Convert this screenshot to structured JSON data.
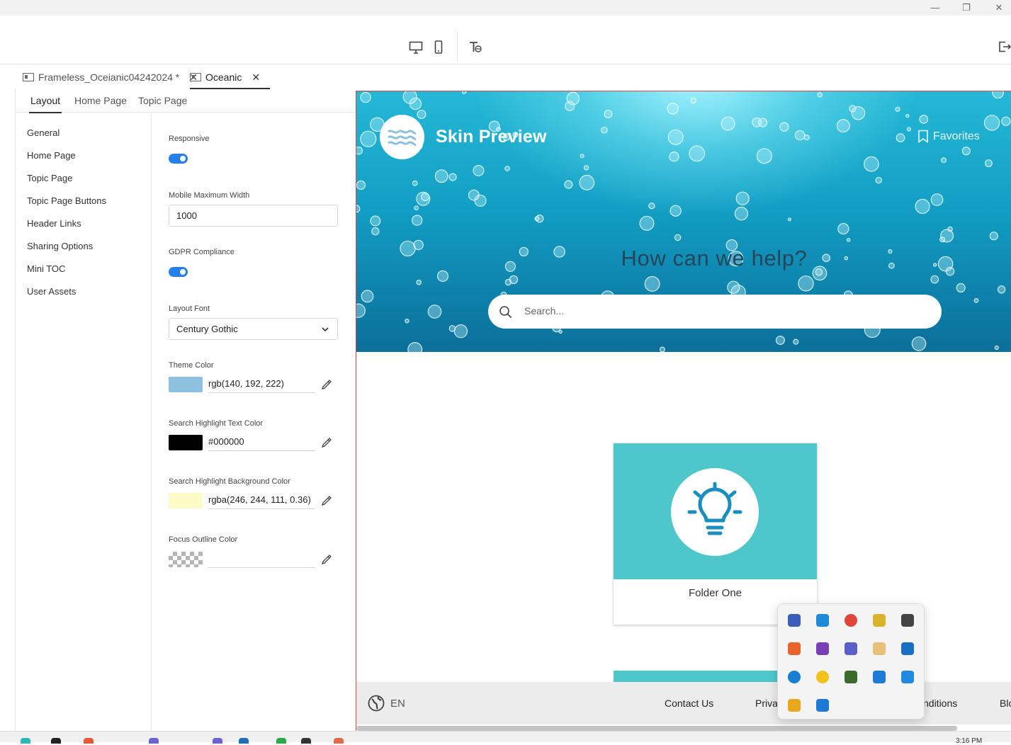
{
  "window": {
    "minimize": "—",
    "restore": "❐",
    "close": "✕"
  },
  "doc_tabs": [
    {
      "label": "Frameless_Oceianic04242024 *",
      "close": "✕"
    },
    {
      "label": "Oceanic",
      "close": "✕"
    }
  ],
  "settings_tabs": [
    "Layout",
    "Home Page",
    "Topic Page"
  ],
  "sidenav": [
    "General",
    "Home Page",
    "Topic Page",
    "Topic Page Buttons",
    "Header Links",
    "Sharing Options",
    "Mini TOC",
    "User Assets"
  ],
  "form": {
    "responsive_label": "Responsive",
    "responsive_on": true,
    "mobile_width_label": "Mobile Maximum Width",
    "mobile_width_value": "1000",
    "gdpr_label": "GDPR Compliance",
    "gdpr_on": true,
    "font_label": "Layout Font",
    "font_value": "Century Gothic",
    "theme_label": "Theme Color",
    "theme_value": "rgb(140, 192, 222)",
    "theme_swatch": "#8cc0de",
    "hl_text_label": "Search Highlight Text Color",
    "hl_text_value": "#000000",
    "hl_text_swatch": "#000000",
    "hl_bg_label": "Search Highlight Background Color",
    "hl_bg_value": "rgba(246, 244, 111, 0.36)",
    "hl_bg_swatch": "#fbfbc6",
    "focus_label": "Focus Outline Color",
    "focus_value": ""
  },
  "preview": {
    "title": "Skin Preview",
    "favorites": "Favorites",
    "help_heading": "How can we help?",
    "search_placeholder": "Search...",
    "card_label": "Folder One",
    "footer_lang": "EN",
    "footer_links": [
      "Contact Us",
      "Priva",
      "nditions",
      "Blo"
    ]
  },
  "colors": {
    "accent": "#2680eb",
    "card": "#4ec7cb",
    "ocean": "#1aa6cc"
  },
  "tray_icons": [
    "teams-work-icon",
    "edge-icon",
    "chrome-icon",
    "security-shield-icon",
    "cloud-sync-icon",
    "brave-icon",
    "onenote-icon",
    "teams-icon",
    "mail-icon",
    "outlook-icon",
    "sync-swirl-icon",
    "yellow-circle-icon",
    "nvidia-icon",
    "defender-icon",
    "onedrive-icon",
    "weather-icon",
    "bluetooth-icon"
  ],
  "clock": "3:16 PM"
}
